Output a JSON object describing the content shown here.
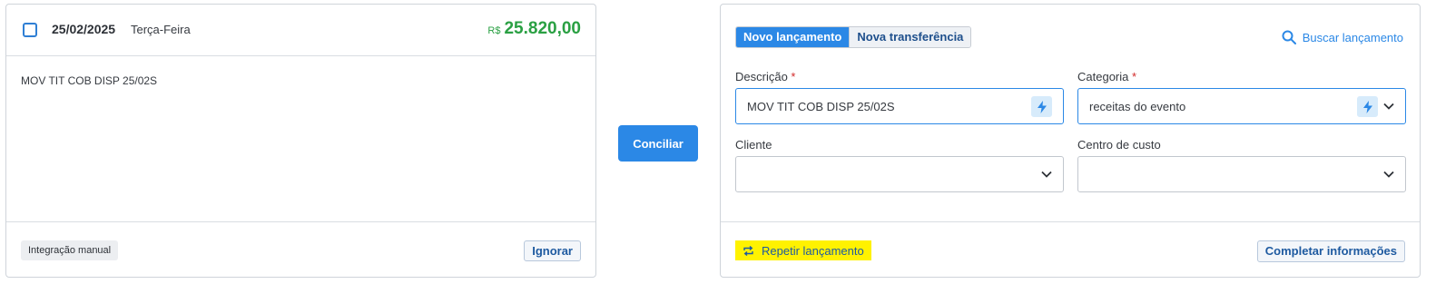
{
  "statement": {
    "date": "25/02/2025",
    "weekday": "Terça-Feira",
    "currency": "R$",
    "amount": "25.820,00",
    "description": "MOV TIT COB DISP 25/02S",
    "source_tag": "Integração manual",
    "ignore_label": "Ignorar"
  },
  "actions": {
    "conciliar_label": "Conciliar"
  },
  "entry": {
    "tabs": [
      {
        "label": "Novo lançamento",
        "active": true
      },
      {
        "label": "Nova transferência",
        "active": false
      }
    ],
    "search_label": "Buscar lançamento",
    "description_label": "Descrição",
    "description_value": "MOV TIT COB DISP  25/02S",
    "category_label": "Categoria",
    "category_value": "receitas do evento",
    "client_label": "Cliente",
    "client_value": "",
    "cost_center_label": "Centro de custo",
    "cost_center_value": "",
    "required_mark": "*",
    "repeat_label": "Repetir lançamento",
    "complete_label": "Completar informações"
  },
  "colors": {
    "accent": "#2b88e6",
    "amount_green": "#2aa043",
    "highlight_yellow": "#fff200"
  }
}
